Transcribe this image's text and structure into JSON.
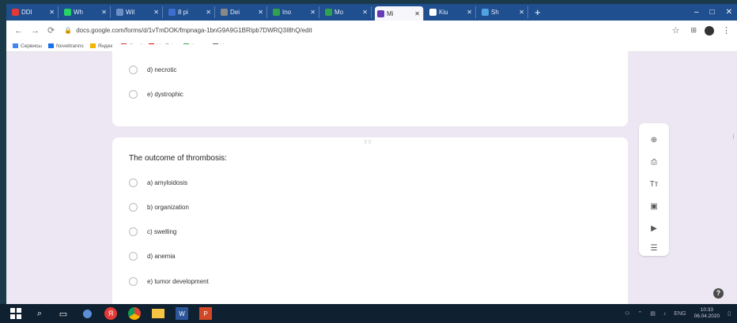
{
  "browser": {
    "tabs": [
      {
        "label": "DDI",
        "icon": "youtube-icon",
        "color": "#e53935"
      },
      {
        "label": "Wh",
        "icon": "whatsapp-icon",
        "color": "#25d366"
      },
      {
        "label": "Wil",
        "icon": "globe-icon",
        "color": "#6c8fc8"
      },
      {
        "label": "8 pi",
        "icon": "globe-icon",
        "color": "#3d6fd1"
      },
      {
        "label": "Dei",
        "icon": "doc-icon",
        "color": "#888"
      },
      {
        "label": "Ino",
        "icon": "drive-icon",
        "color": "#30a14e"
      },
      {
        "label": "Mo",
        "icon": "drive-icon",
        "color": "#30a14e"
      },
      {
        "label": "Mi",
        "icon": "forms-icon",
        "color": "#673ab7",
        "active": true
      },
      {
        "label": "Kiu",
        "icon": "bird-icon",
        "color": "#fff"
      },
      {
        "label": "Sh",
        "icon": "image-icon",
        "color": "#4fa3e0"
      }
    ],
    "url": "docs.google.com/forms/d/1vTmDOK/fmpnaga-1bnG9A9G1BRIpb7DWRQ3I8hQ/edit",
    "bookmarks": [
      {
        "label": "Сервисы",
        "icon": "apps-icon",
        "color": "#4285f4"
      },
      {
        "label": "Noveltranns",
        "icon": "translate-icon",
        "color": "#1a73e8"
      },
      {
        "label": "Яндекс",
        "icon": "drive-icon",
        "color": "#f4b400"
      },
      {
        "label": "Gmail",
        "icon": "gmail-icon",
        "color": "#d93025"
      },
      {
        "label": "YouTube",
        "icon": "youtube-icon",
        "color": "#ff0000"
      },
      {
        "label": "Карты",
        "icon": "maps-icon",
        "color": "#34a853"
      },
      {
        "label": "Новая вкладка",
        "icon": "globe-icon",
        "color": "#5f6368"
      }
    ]
  },
  "form": {
    "prev_options": [
      "d) necrotic",
      "e) dystrophic"
    ],
    "question": "The outcome of thrombosis:",
    "drag_handle": "⠿⠿",
    "options": [
      "a) amyloidosis",
      "b) organization",
      "c) swelling",
      "d) anemia",
      "e) tumor development"
    ]
  },
  "toolbar_tools": [
    {
      "name": "add-question-icon",
      "glyph": "⊕"
    },
    {
      "name": "import-questions-icon",
      "glyph": "⎙"
    },
    {
      "name": "add-title-icon",
      "glyph": "Tт"
    },
    {
      "name": "add-image-icon",
      "glyph": "▣"
    },
    {
      "name": "add-video-icon",
      "glyph": "▶"
    },
    {
      "name": "add-section-icon",
      "glyph": "☰"
    }
  ],
  "taskbar": {
    "clock_time": "10:33",
    "clock_date": "06.04.2020",
    "lang": "ENG"
  },
  "colors": {
    "background": "#ece7f3",
    "accent": "#673ab7"
  }
}
